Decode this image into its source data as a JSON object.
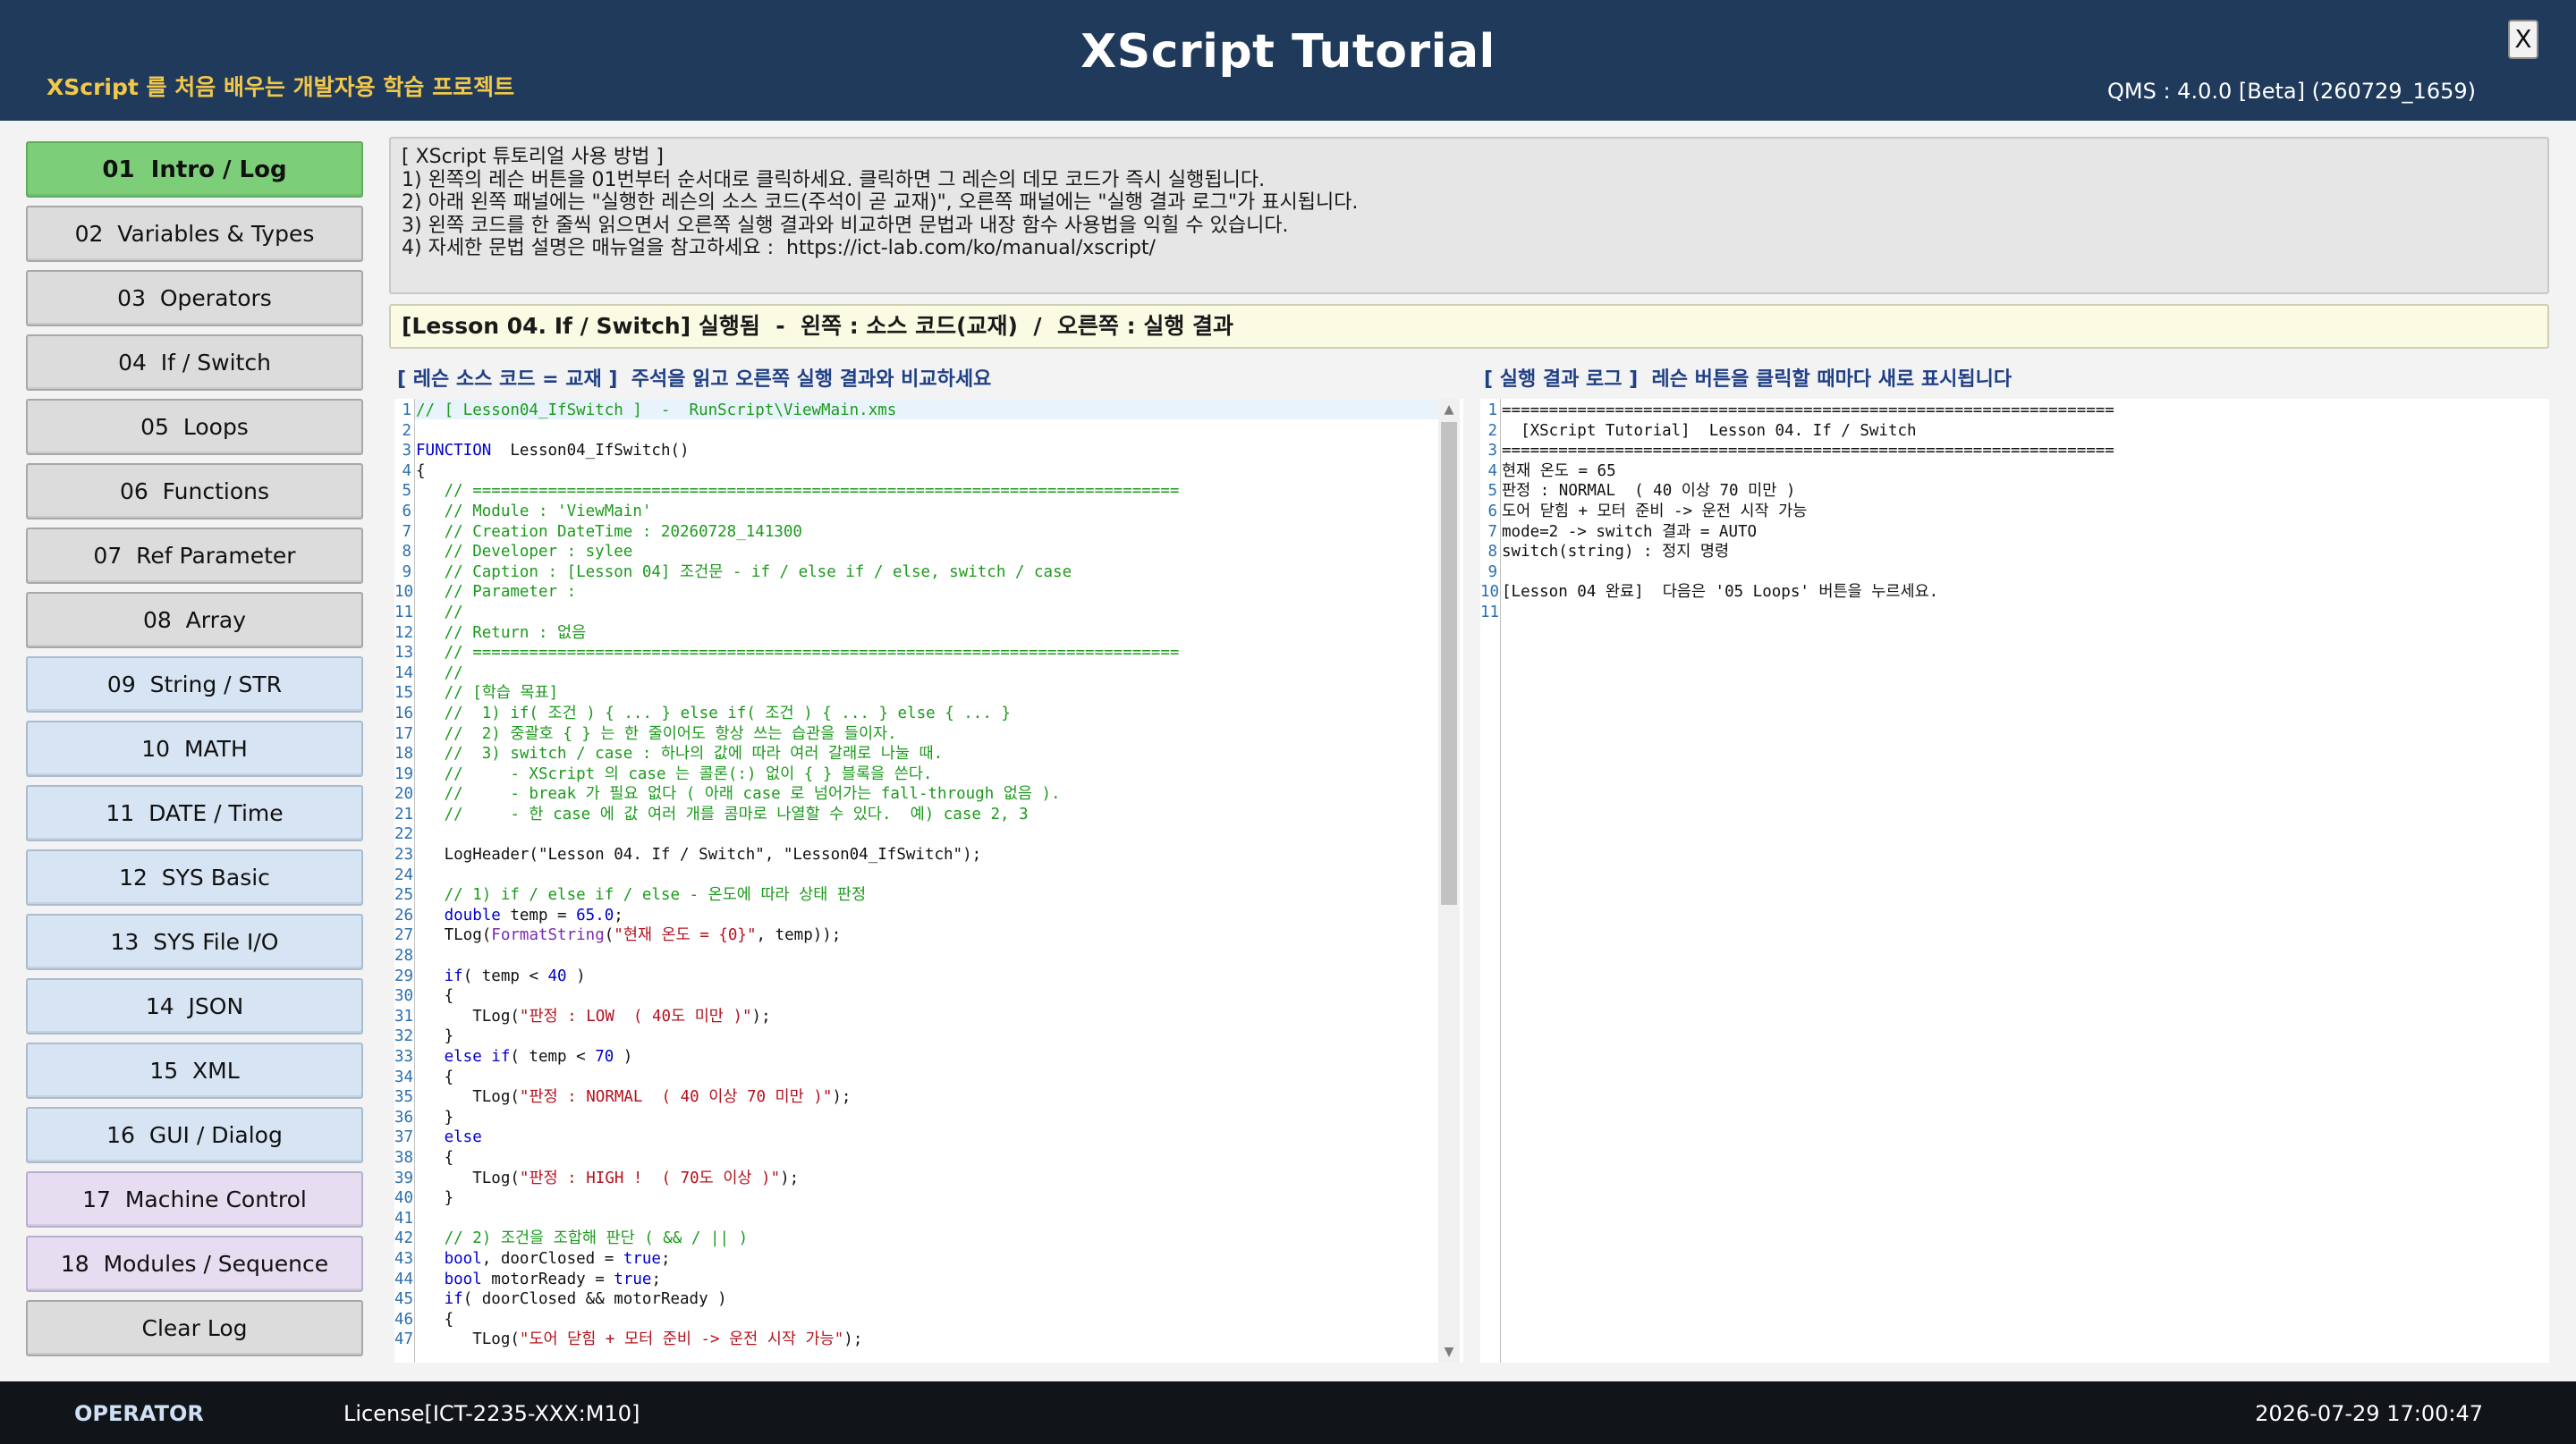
{
  "header": {
    "title": "XScript Tutorial",
    "subtitle": "XScript 를 처음 배우는 개발자용 학습 프로젝트",
    "version": "QMS : 4.0.0 [Beta] (260729_1659)",
    "close_label": "X"
  },
  "sidebar": {
    "items": [
      {
        "label": "01  Intro / Log"
      },
      {
        "label": "02  Variables & Types"
      },
      {
        "label": "03  Operators"
      },
      {
        "label": "04  If / Switch"
      },
      {
        "label": "05  Loops"
      },
      {
        "label": "06  Functions"
      },
      {
        "label": "07  Ref Parameter"
      },
      {
        "label": "08  Array"
      },
      {
        "label": "09  String / STR"
      },
      {
        "label": "10  MATH"
      },
      {
        "label": "11  DATE / Time"
      },
      {
        "label": "12  SYS Basic"
      },
      {
        "label": "13  SYS File I/O"
      },
      {
        "label": "14  JSON"
      },
      {
        "label": "15  XML"
      },
      {
        "label": "16  GUI / Dialog"
      },
      {
        "label": "17  Machine Control"
      },
      {
        "label": "18  Modules / Sequence"
      }
    ],
    "clear_label": "Clear Log"
  },
  "instructions": [
    "[ XScript 튜토리얼 사용 방법 ]",
    "1) 왼쪽의 레슨 버튼을 01번부터 순서대로 클릭하세요. 클릭하면 그 레슨의 데모 코드가 즉시 실행됩니다.",
    "2) 아래 왼쪽 패널에는 \"실행한 레슨의 소스 코드(주석이 곧 교재)\", 오른쪽 패널에는 \"실행 결과 로그\"가 표시됩니다.",
    "3) 왼쪽 코드를 한 줄씩 읽으면서 오른쪽 실행 결과와 비교하면 문법과 내장 함수 사용법을 익힐 수 있습니다.",
    "4) 자세한 문법 설명은 매뉴얼을 참고하세요 :  https://ict-lab.com/ko/manual/xscript/"
  ],
  "banner": "[Lesson 04. If / Switch] 실행됨  -  왼쪽 : 소스 코드(교재)  /  오른쪽 : 실행 결과",
  "code_panel": {
    "header": "[ 레슨 소스 코드 = 교재 ]  주석을 읽고 오른쪽 실행 결과와 비교하세요",
    "lines": [
      [
        [
          "c-cm",
          "// [ Lesson04_IfSwitch ]  -  RunScript\\ViewMain.xms"
        ]
      ],
      [],
      [
        [
          "c-kw",
          "FUNCTION"
        ],
        [
          "",
          "  Lesson04_IfSwitch()"
        ]
      ],
      [
        [
          "",
          "{"
        ]
      ],
      [
        [
          "c-cm",
          "   // ==========================================================================="
        ]
      ],
      [
        [
          "c-cm",
          "   // Module : 'ViewMain'"
        ]
      ],
      [
        [
          "c-cm",
          "   // Creation DateTime : 20260728_141300"
        ]
      ],
      [
        [
          "c-cm",
          "   // Developer : sylee"
        ]
      ],
      [
        [
          "c-cm",
          "   // Caption : [Lesson 04] 조건문 - if / else if / else, switch / case"
        ]
      ],
      [
        [
          "c-cm",
          "   // Parameter :"
        ]
      ],
      [
        [
          "c-cm",
          "   //"
        ]
      ],
      [
        [
          "c-cm",
          "   // Return : 없음"
        ]
      ],
      [
        [
          "c-cm",
          "   // ==========================================================================="
        ]
      ],
      [
        [
          "c-cm",
          "   //"
        ]
      ],
      [
        [
          "c-cm",
          "   // [학습 목표]"
        ]
      ],
      [
        [
          "c-cm",
          "   //  1) if( 조건 ) { ... } else if( 조건 ) { ... } else { ... }"
        ]
      ],
      [
        [
          "c-cm",
          "   //  2) 중괄호 { } 는 한 줄이어도 항상 쓰는 습관을 들이자."
        ]
      ],
      [
        [
          "c-cm",
          "   //  3) switch / case : 하나의 값에 따라 여러 갈래로 나눌 때."
        ]
      ],
      [
        [
          "c-cm",
          "   //     - XScript 의 case 는 콜론(:) 없이 { } 블록을 쓴다."
        ]
      ],
      [
        [
          "c-cm",
          "   //     - break 가 필요 없다 ( 아래 case 로 넘어가는 fall-through 없음 )."
        ]
      ],
      [
        [
          "c-cm",
          "   //     - 한 case 에 값 여러 개를 콤마로 나열할 수 있다.  예) case 2, 3"
        ]
      ],
      [],
      [
        [
          "",
          "   LogHeader(\"Lesson 04. If / Switch\", \"Lesson04_IfSwitch\");"
        ]
      ],
      [],
      [
        [
          "c-cm",
          "   // 1) if / else if / else - 온도에 따라 상태 판정"
        ]
      ],
      [
        [
          "c-kw",
          "   double"
        ],
        [
          "",
          " temp = "
        ],
        [
          "c-num",
          "65.0"
        ],
        [
          "",
          ";"
        ]
      ],
      [
        [
          "",
          "   TLog("
        ],
        [
          "c-fn",
          "FormatString"
        ],
        [
          "",
          "("
        ],
        [
          "c-str",
          "\"현재 온도 = {0}\""
        ],
        [
          "",
          ", temp));"
        ]
      ],
      [],
      [
        [
          "c-kw",
          "   if"
        ],
        [
          "",
          "( temp < "
        ],
        [
          "c-num",
          "40"
        ],
        [
          "",
          " )"
        ]
      ],
      [
        [
          "",
          "   {"
        ]
      ],
      [
        [
          "",
          "      TLog("
        ],
        [
          "c-str",
          "\"판정 : LOW  ( 40도 미만 )\""
        ],
        [
          "",
          ");"
        ]
      ],
      [
        [
          "",
          "   }"
        ]
      ],
      [
        [
          "c-kw",
          "   else if"
        ],
        [
          "",
          "( temp < "
        ],
        [
          "c-num",
          "70"
        ],
        [
          "",
          " )"
        ]
      ],
      [
        [
          "",
          "   {"
        ]
      ],
      [
        [
          "",
          "      TLog("
        ],
        [
          "c-str",
          "\"판정 : NORMAL  ( 40 이상 70 미만 )\""
        ],
        [
          "",
          ");"
        ]
      ],
      [
        [
          "",
          "   }"
        ]
      ],
      [
        [
          "c-kw",
          "   else"
        ]
      ],
      [
        [
          "",
          "   {"
        ]
      ],
      [
        [
          "",
          "      TLog("
        ],
        [
          "c-str",
          "\"판정 : HIGH !  ( 70도 이상 )\""
        ],
        [
          "",
          ");"
        ]
      ],
      [
        [
          "",
          "   }"
        ]
      ],
      [],
      [
        [
          "c-cm",
          "   // 2) 조건을 조합해 판단 ( && / || )"
        ]
      ],
      [
        [
          "c-kw",
          "   bool"
        ],
        [
          "",
          ", doorClosed = "
        ],
        [
          "c-kw",
          "true"
        ],
        [
          "",
          ";"
        ]
      ],
      [
        [
          "c-kw",
          "   bool"
        ],
        [
          "",
          " motorReady = "
        ],
        [
          "c-kw",
          "true"
        ],
        [
          "",
          ";"
        ]
      ],
      [
        [
          "c-kw",
          "   if"
        ],
        [
          "",
          "( doorClosed && motorReady )"
        ]
      ],
      [
        [
          "",
          "   {"
        ]
      ],
      [
        [
          "",
          "      TLog("
        ],
        [
          "c-str",
          "\"도어 닫힘 + 모터 준비 -> 운전 시작 가능\""
        ],
        [
          "",
          ");"
        ]
      ]
    ]
  },
  "log_panel": {
    "header": "[ 실행 결과 로그 ]  레슨 버튼을 클릭할 때마다 새로 표시됩니다",
    "lines": [
      "=================================================================",
      "  [XScript Tutorial]  Lesson 04. If / Switch",
      "=================================================================",
      "현재 온도 = 65",
      "판정 : NORMAL  ( 40 이상 70 미만 )",
      "도어 닫힘 + 모터 준비 -> 운전 시작 가능",
      "mode=2 -> switch 결과 = AUTO",
      "switch(string) : 정지 명령",
      "",
      "[Lesson 04 완료]  다음은 '05 Loops' 버튼을 누르세요.",
      ""
    ]
  },
  "footer": {
    "role": "OPERATOR",
    "license": "License[ICT-2235-XXX:M10]",
    "clock": "2026-07-29 17:00:47"
  }
}
